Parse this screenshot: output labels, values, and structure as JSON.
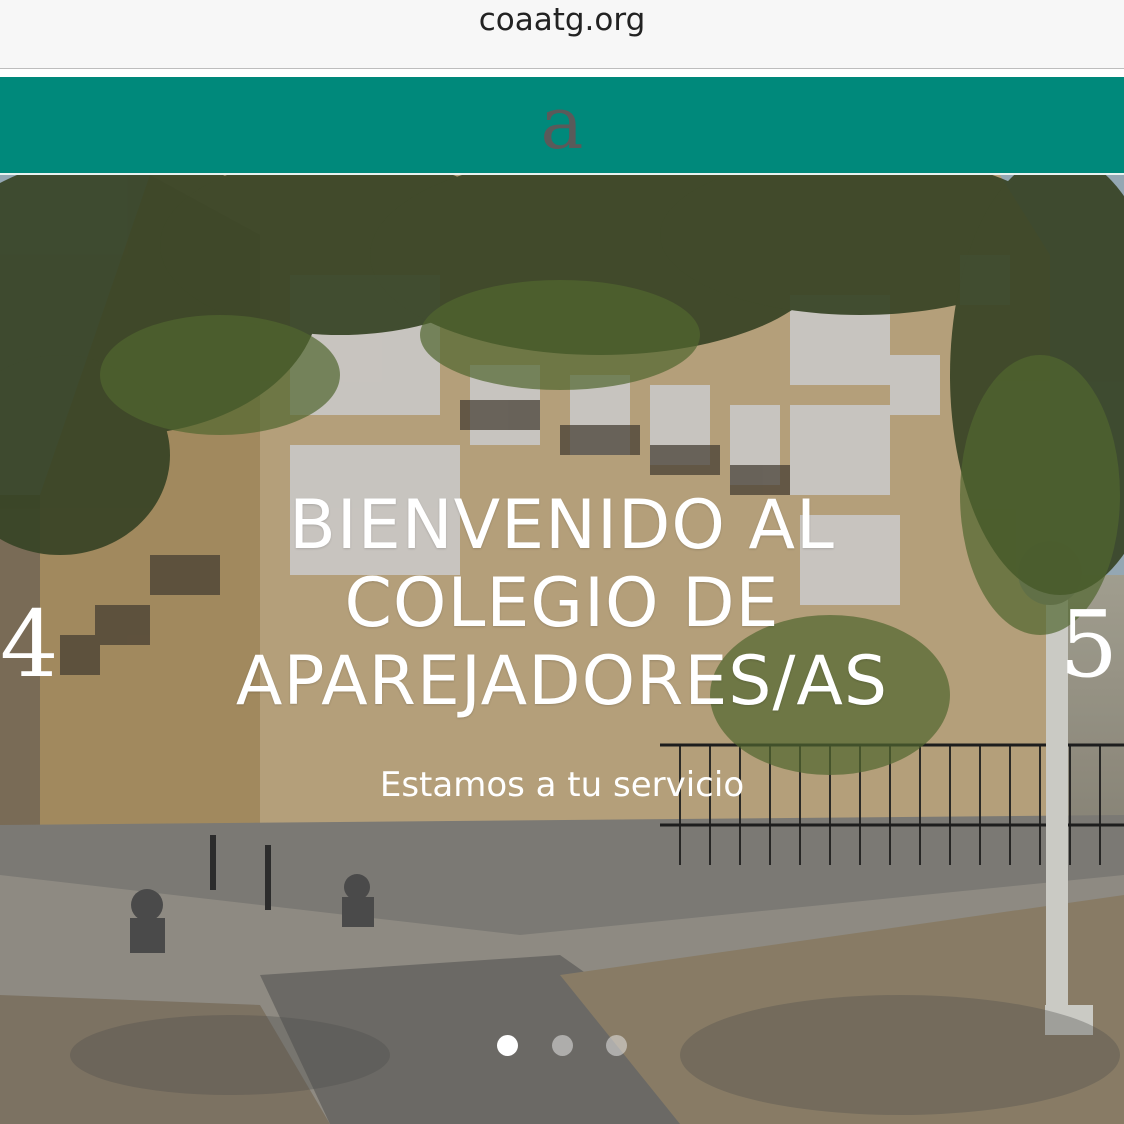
{
  "browser": {
    "url": "coaatg.org"
  },
  "header": {
    "logo_letter": "a",
    "color": "#00897b"
  },
  "hero": {
    "title": "BIENVENIDO AL COLEGIO DE APAREJADORES/AS",
    "subtitle": "Estamos a tu servicio",
    "prev_label": "4",
    "next_label": "5",
    "slides": 3,
    "active_slide": 1
  }
}
